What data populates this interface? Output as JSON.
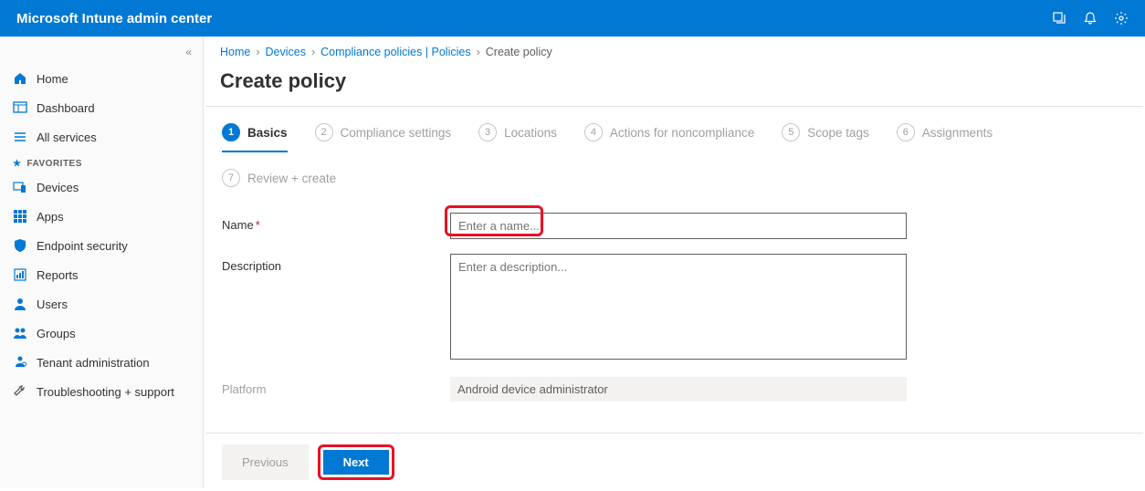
{
  "header": {
    "title": "Microsoft Intune admin center"
  },
  "sidebar": {
    "home": "Home",
    "dashboard": "Dashboard",
    "all_services": "All services",
    "favorites_label": "FAVORITES",
    "devices": "Devices",
    "apps": "Apps",
    "endpoint_security": "Endpoint security",
    "reports": "Reports",
    "users": "Users",
    "groups": "Groups",
    "tenant_admin": "Tenant administration",
    "troubleshooting": "Troubleshooting + support"
  },
  "breadcrumb": {
    "home": "Home",
    "devices": "Devices",
    "compliance": "Compliance policies | Policies",
    "current": "Create policy"
  },
  "page": {
    "title": "Create policy"
  },
  "wizard": {
    "steps": [
      {
        "num": "1",
        "label": "Basics"
      },
      {
        "num": "2",
        "label": "Compliance settings"
      },
      {
        "num": "3",
        "label": "Locations"
      },
      {
        "num": "4",
        "label": "Actions for noncompliance"
      },
      {
        "num": "5",
        "label": "Scope tags"
      },
      {
        "num": "6",
        "label": "Assignments"
      },
      {
        "num": "7",
        "label": "Review + create"
      }
    ]
  },
  "form": {
    "name_label": "Name",
    "name_placeholder": "Enter a name...",
    "description_label": "Description",
    "description_placeholder": "Enter a description...",
    "platform_label": "Platform",
    "platform_value": "Android device administrator"
  },
  "footer": {
    "previous": "Previous",
    "next": "Next"
  }
}
